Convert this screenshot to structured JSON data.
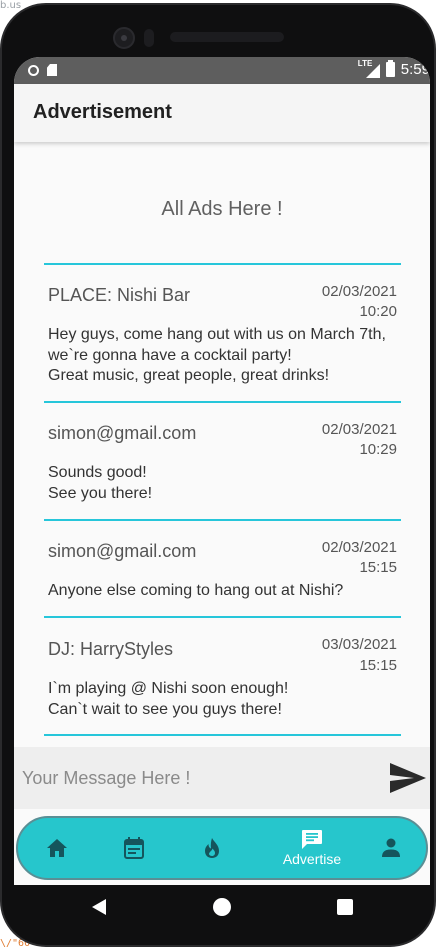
{
  "status_bar": {
    "network": "LTE",
    "time": "5:59"
  },
  "app_bar": {
    "title": "Advertisement"
  },
  "page": {
    "heading": "All Ads Here !"
  },
  "ads": [
    {
      "author": "PLACE: Nishi Bar",
      "date": "02/03/2021",
      "time": "10:20",
      "lines": [
        "Hey guys, come hang out with us on March 7th,",
        "we`re gonna have a cocktail party!",
        "Great music, great people, great drinks!"
      ]
    },
    {
      "author": "simon@gmail.com",
      "date": "02/03/2021",
      "time": "10:29",
      "lines": [
        "Sounds good!",
        "See you there!"
      ]
    },
    {
      "author": "simon@gmail.com",
      "date": "02/03/2021",
      "time": "15:15",
      "lines": [
        "Anyone else coming to hang out at Nishi?"
      ]
    },
    {
      "author": "DJ: HarryStyles",
      "date": "03/03/2021",
      "time": "15:15",
      "lines": [
        "I`m playing @ Nishi soon enough!",
        "Can`t wait to see you guys there!"
      ]
    }
  ],
  "message_bar": {
    "value": "",
    "placeholder": "Your Message Here !",
    "send_icon": "send-icon"
  },
  "bottom_nav": {
    "items": [
      {
        "icon": "home-icon",
        "label": "",
        "active": false
      },
      {
        "icon": "calendar-icon",
        "label": "",
        "active": false
      },
      {
        "icon": "fire-icon",
        "label": "",
        "active": false
      },
      {
        "icon": "chat-icon",
        "label": "Advertise",
        "active": true
      },
      {
        "icon": "person-icon",
        "label": "",
        "active": false
      }
    ]
  },
  "fragments": {
    "top_left": "b.us",
    "bottom_left": "\\/\"60"
  },
  "colors": {
    "accent": "#26c6da",
    "nav_background": "#26c6cc",
    "status_bar": "#5e5e5e",
    "screen_background": "#fafafa"
  }
}
